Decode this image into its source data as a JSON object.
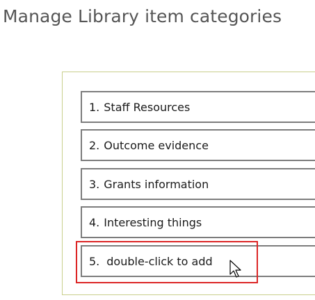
{
  "page": {
    "title": "Manage Library item categories"
  },
  "categories": [
    {
      "number": "1.",
      "label": "Staff Resources"
    },
    {
      "number": "2.",
      "label": "Outcome evidence"
    },
    {
      "number": "3.",
      "label": "Grants information"
    },
    {
      "number": "4.",
      "label": "Interesting things"
    }
  ],
  "add_item": {
    "number": "5.",
    "label": "double-click to add"
  },
  "colors": {
    "title": "#555555",
    "panel_border": "#c9cf8c",
    "item_border": "#7c7c7c",
    "highlight": "#dc2424"
  },
  "icons": {
    "cursor": "mouse-pointer-icon"
  }
}
